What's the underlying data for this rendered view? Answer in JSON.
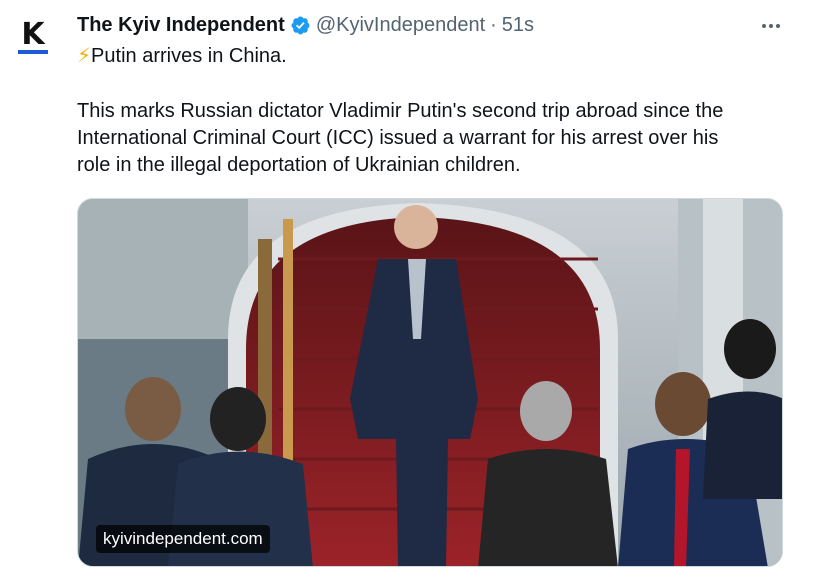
{
  "author": {
    "display_name": "The Kyiv Independent",
    "handle": "@KyivIndependent",
    "separator": "·",
    "time": "51s",
    "avatar_letter": "K",
    "avatar_icon": "kyiv-independent-logo",
    "verified_icon": "verified-badge-icon",
    "verified_color": "#1d9bf0"
  },
  "menu_icon": "more-horizontal-icon",
  "body": {
    "headline_icon": "⚡",
    "headline": "Putin arrives in China.",
    "lines": [
      "This marks Russian dictator Vladimir Putin's second trip abroad since the",
      "International Criminal Court (ICC) issued a warrant for his arrest over his",
      "role in the illegal deportation of Ukrainian children."
    ]
  },
  "media": {
    "domain": "kyivindependent.com"
  },
  "colors": {
    "text": "#0f1419",
    "secondary": "#536471",
    "border": "#cfd9de",
    "carpet": "#8b1f24"
  }
}
